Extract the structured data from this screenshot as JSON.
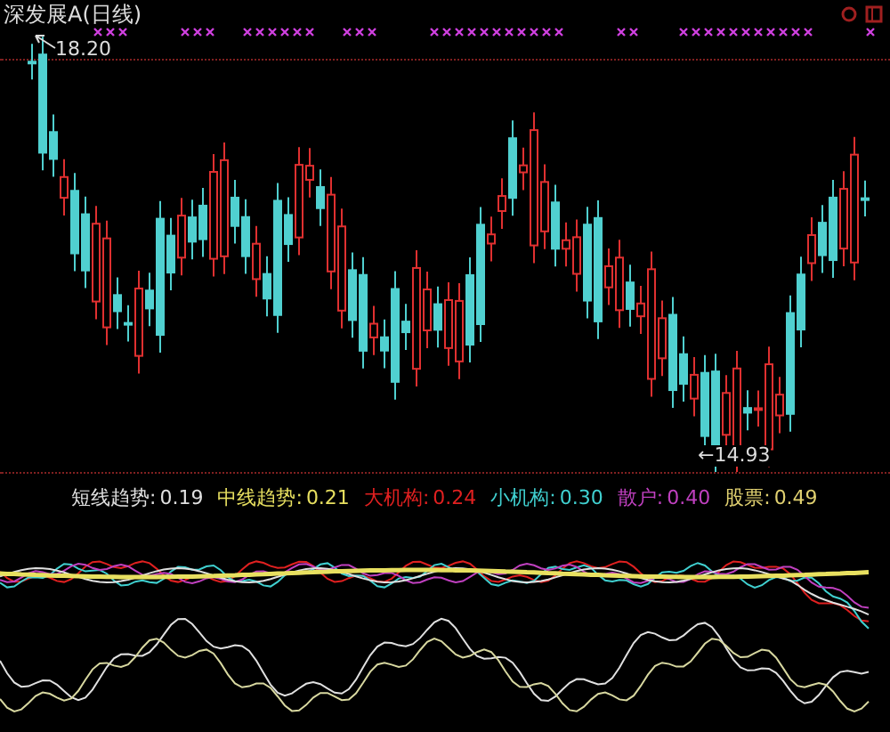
{
  "chart": {
    "title": "深发展A(日线)",
    "high_label": "18.20",
    "low_label": "←14.93"
  },
  "legend": [
    {
      "label": "短线趋势:",
      "value": "0.19",
      "color": "#e0e0e0"
    },
    {
      "label": "中线趋势:",
      "value": "0.21",
      "color": "#e8e060"
    },
    {
      "label": "大机构:",
      "value": "0.24",
      "color": "#e02020"
    },
    {
      "label": "小机构:",
      "value": "0.30",
      "color": "#40d0d0"
    },
    {
      "label": "散户:",
      "value": "0.40",
      "color": "#c040c0"
    },
    {
      "label": "股票:",
      "value": "0.49",
      "color": "#e0d070"
    }
  ]
}
